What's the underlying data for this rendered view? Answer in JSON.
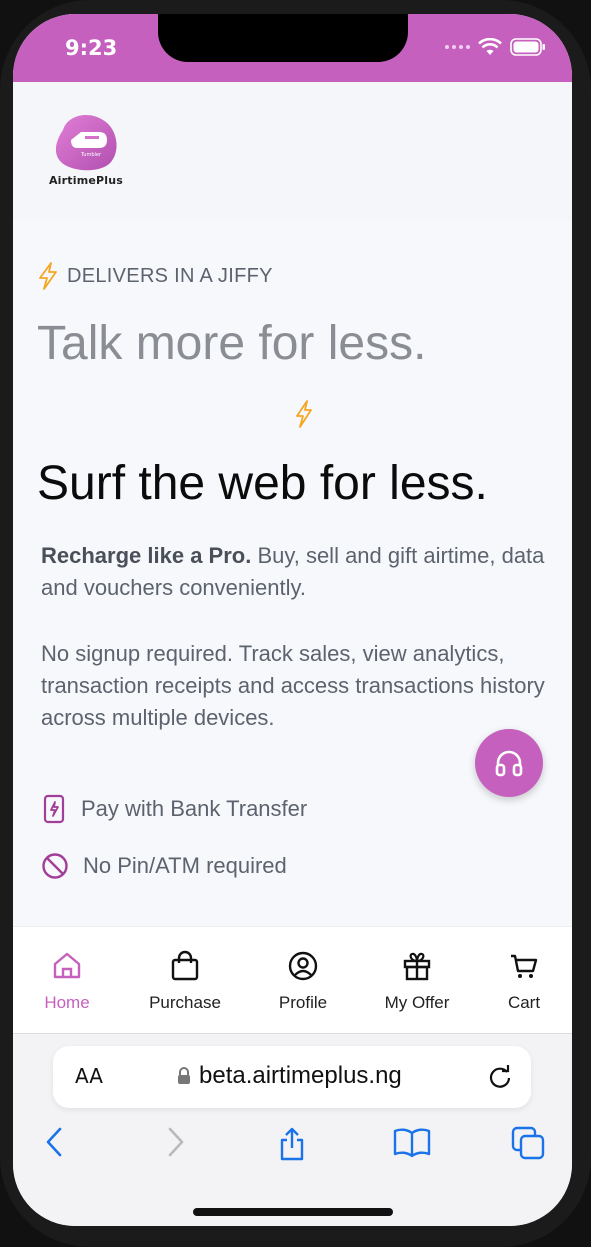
{
  "status_bar": {
    "time": "9:23",
    "color": "#c660be"
  },
  "header": {
    "logo_text": "AirtimePlus",
    "logo_mark_text": "Tumbler"
  },
  "hero": {
    "badge_label": "DELIVERS IN A JIFFY",
    "tagline_1": "Talk more for less.",
    "tagline_2": "Surf the web for less.",
    "desc_bold": "Recharge like a Pro.",
    "desc_rest": " Buy, sell and gift airtime, data and vouchers conveniently.",
    "desc_2": "No signup required. Track sales, view analytics, transaction receipts and access transactions history across multiple devices.",
    "features": [
      {
        "icon": "bank-transfer-icon",
        "label": "Pay with Bank Transfer"
      },
      {
        "icon": "no-pin-icon",
        "label": "No Pin/ATM required"
      }
    ]
  },
  "support_button": {
    "icon": "headset-icon"
  },
  "bottom_nav": {
    "items": [
      {
        "label": "Home",
        "icon": "home-icon",
        "active": true
      },
      {
        "label": "Purchase",
        "icon": "bag-icon"
      },
      {
        "label": "Profile",
        "icon": "profile-icon"
      },
      {
        "label": "My Offer",
        "icon": "gift-icon"
      },
      {
        "label": "Cart",
        "icon": "cart-icon"
      }
    ]
  },
  "browser": {
    "aa_label": "AA",
    "url": "beta.airtimeplus.ng"
  },
  "colors": {
    "accent": "#c660be",
    "ios_blue": "#1a73e8",
    "bolt": "#f5a623"
  }
}
